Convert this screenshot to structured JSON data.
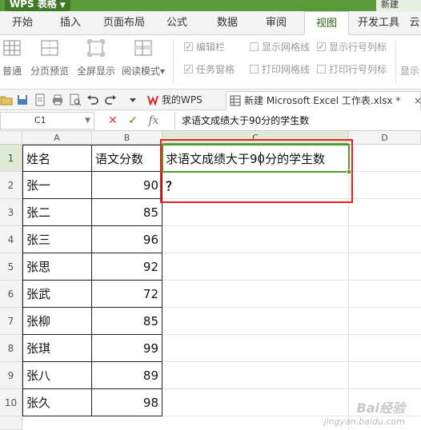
{
  "app": {
    "name": "WPS 表格",
    "new_label": "新建"
  },
  "menu": {
    "tabs": [
      "开始",
      "插入",
      "页面布局",
      "公式",
      "数据",
      "审阅",
      "视图",
      "开发工具",
      "云"
    ],
    "active": "视图"
  },
  "ribbon": {
    "buttons": [
      "普通",
      "分页预览",
      "全屏显示",
      "阅读模式"
    ],
    "dropdown_caret": "▾",
    "checks": [
      {
        "label": "编辑栏",
        "checked": true
      },
      {
        "label": "任务窗格",
        "checked": true
      },
      {
        "label": "显示网格线",
        "checked": false
      },
      {
        "label": "显示行号列标",
        "checked": true
      },
      {
        "label": "打印网格线",
        "checked": false
      },
      {
        "label": "打印行号列标",
        "checked": false
      }
    ],
    "right_clip": "显示"
  },
  "doc_tabs": {
    "home": "我的WPS",
    "file": "新建 Microsoft Excel 工作表.xlsx *",
    "close": "×"
  },
  "formula_bar": {
    "cell_ref": "C1",
    "formula": "求语文成绩大于90分的学生数",
    "cancel": "✕",
    "confirm": "✓",
    "fx": "fx"
  },
  "sheet": {
    "columns": [
      "A",
      "B",
      "C",
      "D"
    ],
    "rows": [
      "1",
      "2",
      "3",
      "4",
      "5",
      "6",
      "7",
      "8",
      "9",
      "10"
    ],
    "header": {
      "name": "姓名",
      "score": "语文分数"
    },
    "students": [
      {
        "name": "张一",
        "score": "90"
      },
      {
        "name": "张二",
        "score": "85"
      },
      {
        "name": "张三",
        "score": "96"
      },
      {
        "name": "张思",
        "score": "92"
      },
      {
        "name": "张武",
        "score": "72"
      },
      {
        "name": "张柳",
        "score": "85"
      },
      {
        "name": "张琪",
        "score": "99"
      },
      {
        "name": "张八",
        "score": "89"
      },
      {
        "name": "张久",
        "score": "98"
      }
    ],
    "c1_text": "求语文成绩大于90分的学生数",
    "c2_text": "？"
  },
  "watermark": {
    "logo": "Bai经验",
    "url": "jingyan.baidu.com"
  },
  "colors": {
    "accent": "#4f9a2a",
    "highlight_box": "#e62020",
    "brand": "#5a9a3a"
  }
}
